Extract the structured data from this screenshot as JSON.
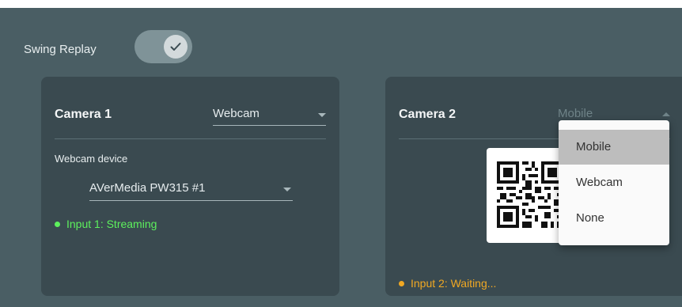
{
  "swing_replay": {
    "label": "Swing Replay",
    "enabled": true
  },
  "camera1": {
    "title": "Camera 1",
    "source": "Webcam",
    "device_label": "Webcam device",
    "device_value": "AVerMedia PW315 #1",
    "status": "Input 1: Streaming",
    "status_color": "#5df05d"
  },
  "camera2": {
    "title": "Camera 2",
    "source": "Mobile",
    "status": "Input 2: Waiting...",
    "status_color": "#f0a823",
    "dropdown_options": [
      "Mobile",
      "Webcam",
      "None"
    ]
  },
  "colors": {
    "panel_bg": "#4a5e64",
    "card_bg": "#3a4a50",
    "accent_green": "#5df05d",
    "accent_orange": "#f0a823"
  }
}
